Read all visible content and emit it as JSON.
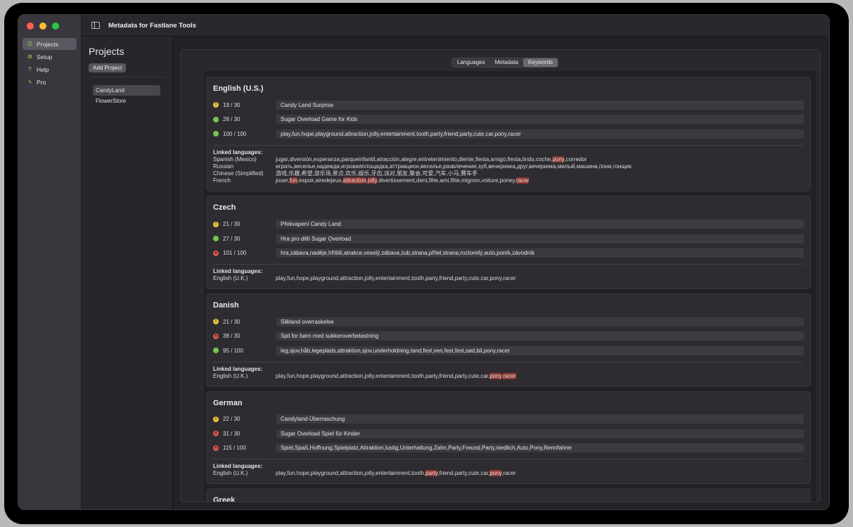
{
  "window": {
    "title": "Metadata for Fastlane Tools"
  },
  "sidebar": {
    "items": [
      {
        "label": "Projects",
        "icon": "list-icon",
        "active": true
      },
      {
        "label": "Setup",
        "icon": "gear-icon",
        "active": false
      },
      {
        "label": "Help",
        "icon": "help-icon",
        "active": false
      },
      {
        "label": "Pro",
        "icon": "bolt-icon",
        "active": false
      }
    ]
  },
  "projects": {
    "title": "Projects",
    "add_label": "Add Project",
    "items": [
      {
        "label": "CandyLand",
        "active": true
      },
      {
        "label": "FlowerStore",
        "active": false
      }
    ]
  },
  "tabs": [
    {
      "label": "Languages",
      "active": false
    },
    {
      "label": "Metadata",
      "active": false
    },
    {
      "label": "Keywords",
      "active": true
    }
  ],
  "linked_heading": "Linked languages:",
  "languages": [
    {
      "name": "English (U.S.)",
      "fields": [
        {
          "status": "warn",
          "count": "19 / 30",
          "value": "Candy Land Surprise"
        },
        {
          "status": "ok",
          "count": "28 / 30",
          "value": "Sugar Overload Game for Kids"
        },
        {
          "status": "ok",
          "count": "100 / 100",
          "value": "play,fun,hope,playground,attraction,jolly,entertainment,tooth,party,friend,party,cute,car,pony,racer"
        }
      ],
      "linked": [
        {
          "name": "Spanish (Mexico)",
          "parts": [
            {
              "text": "jugar,diversión,esperanza,parqueinfantil,atracción,alegre,entretenimiento,diente,fiesta,amigo,fiesta,lindo,coche,",
              "hl": false
            },
            {
              "text": "pony",
              "hl": true
            },
            {
              "text": ",corredor",
              "hl": false
            }
          ]
        },
        {
          "name": "Russian",
          "parts": [
            {
              "text": "играть,веселье,надежда,игроваяплощадка,аттракцион,веселье,развлечение,зуб,вечеринка,друг,вечеринка,милый,машина,пони,гонщик",
              "hl": false
            }
          ]
        },
        {
          "name": "Chinese (Simplified)",
          "parts": [
            {
              "text": "游戏,乐趣,希望,游乐场,景点,欢乐,娱乐,牙齿,派对,朋友,聚会,可爱,汽车,小马,赛车手",
              "hl": false
            }
          ]
        },
        {
          "name": "French",
          "parts": [
            {
              "text": "jouer,",
              "hl": false
            },
            {
              "text": "fun",
              "hl": true
            },
            {
              "text": ",espoir,airedejeux,",
              "hl": false
            },
            {
              "text": "attraction",
              "hl": true
            },
            {
              "text": ",",
              "hl": false
            },
            {
              "text": "jolly",
              "hl": true
            },
            {
              "text": ",divertissement,dent,fête,ami,fête,mignon,voiture,poney,",
              "hl": false
            },
            {
              "text": "racer",
              "hl": true
            }
          ]
        }
      ]
    },
    {
      "name": "Czech",
      "fields": [
        {
          "status": "warn",
          "count": "21 / 30",
          "value": "Překvapení Candy Land"
        },
        {
          "status": "ok",
          "count": "27 / 30",
          "value": "Hra pro děti Sugar Overload"
        },
        {
          "status": "err",
          "count": "101 / 100",
          "value": "hra,zábava,naděje,hřiště,atrakce,veselý,zábava,zub,strana,přítel,strana,roztomilý,auto,poník,závodník"
        }
      ],
      "linked": [
        {
          "name": "English (U.K.)",
          "parts": [
            {
              "text": "play,fun,hope,playground,attraction,jolly,entertainment,tooth,party,friend,party,cute,car,pony,racer",
              "hl": false
            }
          ]
        }
      ]
    },
    {
      "name": "Danish",
      "fields": [
        {
          "status": "warn",
          "count": "21 / 30",
          "value": "Slikland overraskelse"
        },
        {
          "status": "err",
          "count": "38 / 30",
          "value": "Spil for børn med sukkeroverbelastning"
        },
        {
          "status": "ok",
          "count": "95 / 100",
          "value": "leg,sjov,håb,legeplads,attraktion,sjov,underholdning,tand,fest,ven,fest,fest,sød,bil,pony,racer"
        }
      ],
      "linked": [
        {
          "name": "English (U.K.)",
          "parts": [
            {
              "text": "play,fun,hope,playground,attraction,jolly,entertainment,tooth,party,friend,party,cute,car,",
              "hl": false
            },
            {
              "text": "pony",
              "hl": true
            },
            {
              "text": ",",
              "hl": false
            },
            {
              "text": "racer",
              "hl": true
            }
          ]
        }
      ]
    },
    {
      "name": "German",
      "fields": [
        {
          "status": "warn",
          "count": "22 / 30",
          "value": "Candyland-Überraschung"
        },
        {
          "status": "err",
          "count": "31 / 30",
          "value": "Sugar Overload Spiel für Kinder"
        },
        {
          "status": "err",
          "count": "115 / 100",
          "value": "Spiel,Spaß,Hoffnung,Spielplatz,Attraktion,lustig,Unterhaltung,Zahn,Party,Freund,Party,niedlich,Auto,Pony,Rennfahrer"
        }
      ],
      "linked": [
        {
          "name": "English (U.K.)",
          "parts": [
            {
              "text": "play,fun,hope,playground,attraction,jolly,entertainment,tooth,",
              "hl": false
            },
            {
              "text": "party",
              "hl": true
            },
            {
              "text": ",friend,party,cute,car,",
              "hl": false
            },
            {
              "text": "pony",
              "hl": true
            },
            {
              "text": ",racer",
              "hl": false
            }
          ]
        }
      ]
    },
    {
      "name": "Greek",
      "fields": [],
      "linked": []
    }
  ]
}
